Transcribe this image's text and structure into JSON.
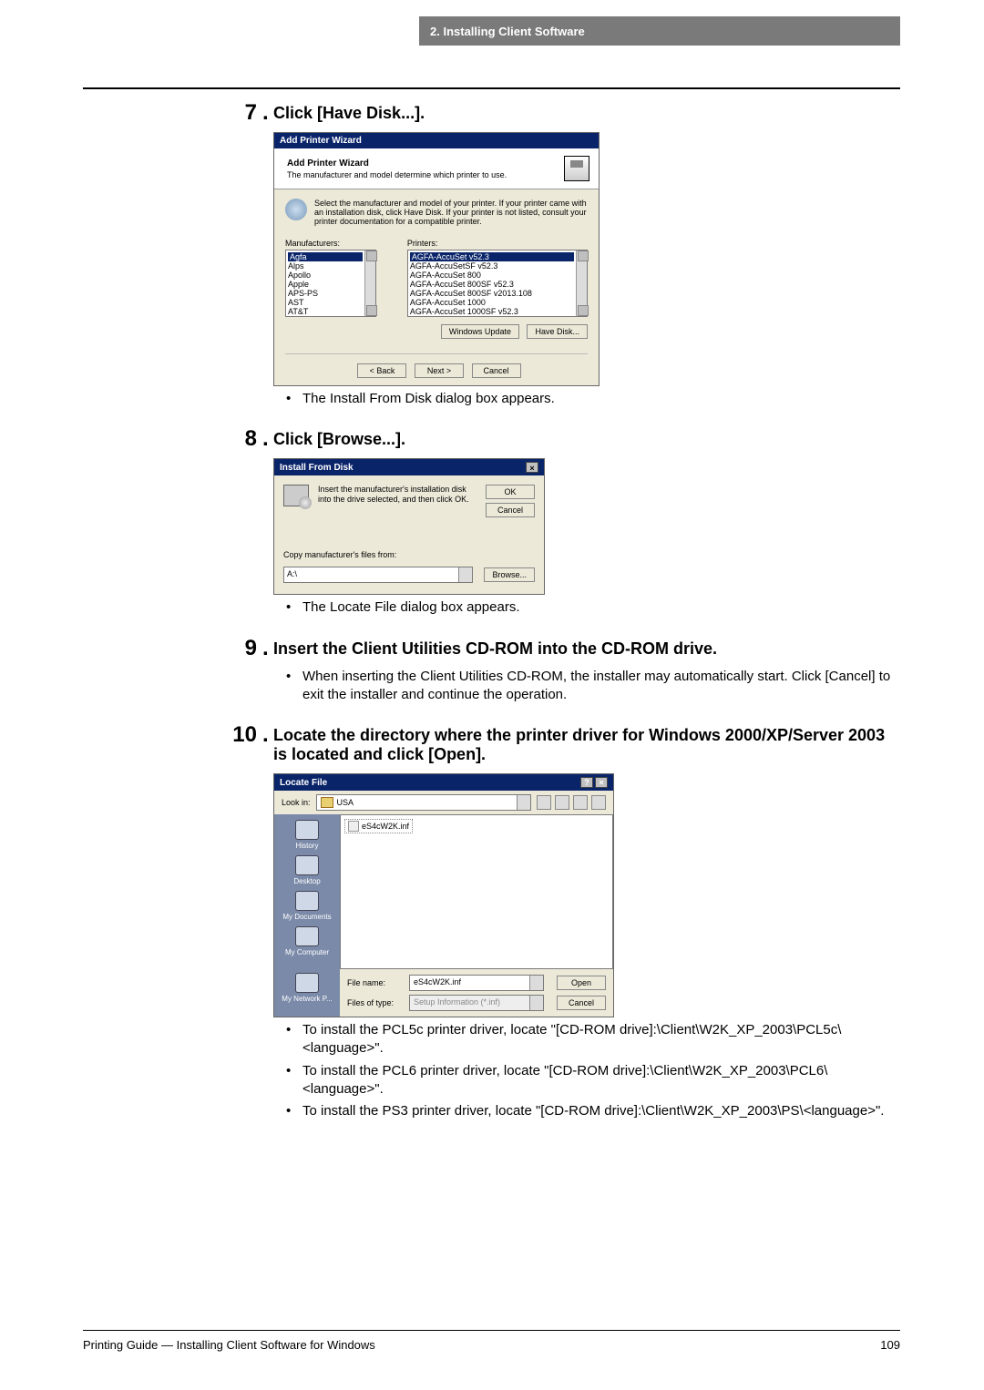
{
  "header": {
    "title": "2. Installing Client Software"
  },
  "steps": {
    "s7": {
      "num": "7",
      "title": "Click [Have Disk...].",
      "note": "The Install From Disk dialog box appears."
    },
    "s8": {
      "num": "8",
      "title": "Click [Browse...].",
      "note": "The Locate File dialog box appears."
    },
    "s9": {
      "num": "9",
      "title": "Insert the Client Utilities CD-ROM into the CD-ROM drive.",
      "note": "When inserting the Client Utilities CD-ROM, the installer may automatically start. Click [Cancel] to exit the installer and continue the operation."
    },
    "s10": {
      "num": "10",
      "title": "Locate the directory where the printer driver for Windows 2000/XP/Server 2003 is located and click [Open].",
      "notes": [
        "To install the PCL5c printer driver, locate \"[CD-ROM drive]:\\Client\\W2K_XP_2003\\PCL5c\\<language>\".",
        "To install the PCL6 printer driver, locate \"[CD-ROM drive]:\\Client\\W2K_XP_2003\\PCL6\\<language>\".",
        "To install the PS3 printer driver, locate \"[CD-ROM drive]:\\Client\\W2K_XP_2003\\PS\\<language>\"."
      ]
    }
  },
  "dlg1": {
    "titlebar": "Add Printer Wizard",
    "head_title": "Add Printer Wizard",
    "head_sub": "The manufacturer and model determine which printer to use.",
    "msg": "Select the manufacturer and model of your printer. If your printer came with an installation disk, click Have Disk. If your printer is not listed, consult your printer documentation for a compatible printer.",
    "mfr_label": "Manufacturers:",
    "ptr_label": "Printers:",
    "mfrs": [
      "Agfa",
      "Alps",
      "Apollo",
      "Apple",
      "APS-PS",
      "AST",
      "AT&T"
    ],
    "printers": [
      "AGFA-AccuSet v52.3",
      "AGFA-AccuSetSF v52.3",
      "AGFA-AccuSet 800",
      "AGFA-AccuSet 800SF v52.3",
      "AGFA-AccuSet 800SF v2013.108",
      "AGFA-AccuSet 1000",
      "AGFA-AccuSet 1000SF v52.3"
    ],
    "btn_wu": "Windows Update",
    "btn_hd": "Have Disk...",
    "btn_back": "< Back",
    "btn_next": "Next >",
    "btn_cancel": "Cancel"
  },
  "dlg2": {
    "titlebar": "Install From Disk",
    "instr": "Insert the manufacturer's installation disk into the drive selected, and then click OK.",
    "btn_ok": "OK",
    "btn_cancel": "Cancel",
    "from_label": "Copy manufacturer's files from:",
    "path": "A:\\",
    "btn_browse": "Browse..."
  },
  "dlg3": {
    "titlebar": "Locate File",
    "lookin_label": "Look in:",
    "lookin_value": "USA",
    "places": [
      "History",
      "Desktop",
      "My Documents",
      "My Computer",
      "My Network P..."
    ],
    "file_item": "eS4cW2K.inf",
    "filename_label": "File name:",
    "filename_value": "eS4cW2K.inf",
    "filetype_label": "Files of type:",
    "filetype_value": "Setup Information (*.inf)",
    "btn_open": "Open",
    "btn_cancel": "Cancel"
  },
  "footer": {
    "left": "Printing Guide — Installing Client Software for Windows",
    "right": "109"
  }
}
